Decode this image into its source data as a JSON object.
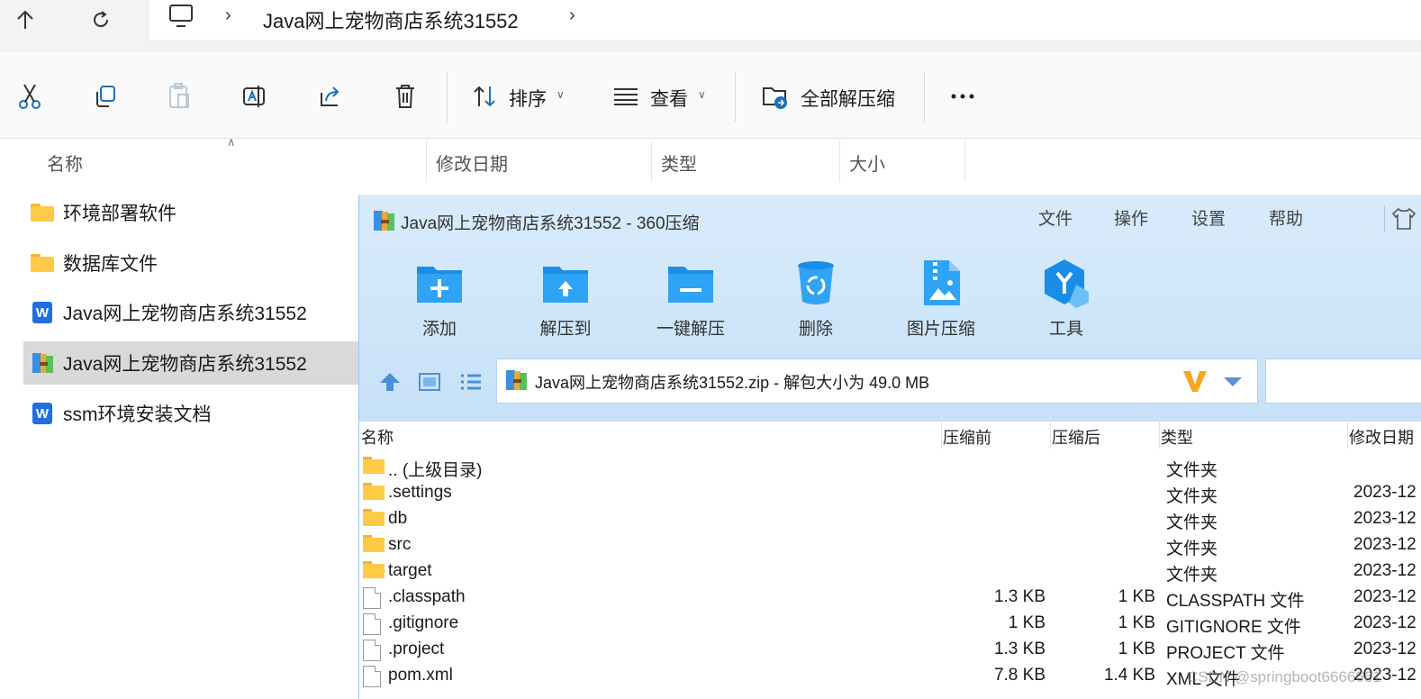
{
  "addressbar": {
    "crumbs": [
      "Java网上宠物商店系统31552"
    ]
  },
  "commandbar": {
    "sort_label": "排序",
    "view_label": "查看",
    "extract_all_label": "全部解压缩"
  },
  "explorer_columns": [
    "名称",
    "修改日期",
    "类型",
    "大小"
  ],
  "explorer_items": [
    {
      "name": "环境部署软件",
      "icon": "folder-icon"
    },
    {
      "name": "数据库文件",
      "icon": "folder-icon"
    },
    {
      "name": "Java网上宠物商店系统31552",
      "icon": "wps-document-icon"
    },
    {
      "name": "Java网上宠物商店系统31552",
      "icon": "zip-archive-icon",
      "selected": true
    },
    {
      "name": "ssm环境安装文档",
      "icon": "wps-document-icon"
    }
  ],
  "app360": {
    "title": "Java网上宠物商店系统31552 - 360压缩",
    "menu": [
      "文件",
      "操作",
      "设置",
      "帮助"
    ],
    "toolbar": [
      "添加",
      "解压到",
      "一键解压",
      "删除",
      "图片压缩",
      "工具"
    ],
    "path_text": "Java网上宠物商店系统31552.zip - 解包大小为 49.0 MB",
    "list_columns": [
      "名称",
      "压缩前",
      "压缩后",
      "类型",
      "修改日期"
    ],
    "rows": [
      {
        "name": ".. (上级目录)",
        "before": "",
        "after": "",
        "type": "文件夹",
        "date": "",
        "icon": "folder-icon"
      },
      {
        "name": ".settings",
        "before": "",
        "after": "",
        "type": "文件夹",
        "date": "2023-12",
        "icon": "folder-icon"
      },
      {
        "name": "db",
        "before": "",
        "after": "",
        "type": "文件夹",
        "date": "2023-12",
        "icon": "folder-icon"
      },
      {
        "name": "src",
        "before": "",
        "after": "",
        "type": "文件夹",
        "date": "2023-12",
        "icon": "folder-icon"
      },
      {
        "name": "target",
        "before": "",
        "after": "",
        "type": "文件夹",
        "date": "2023-12",
        "icon": "folder-icon"
      },
      {
        "name": ".classpath",
        "before": "1.3 KB",
        "after": "1 KB",
        "type": "CLASSPATH 文件",
        "date": "2023-12",
        "icon": "file-icon"
      },
      {
        "name": ".gitignore",
        "before": "1 KB",
        "after": "1 KB",
        "type": "GITIGNORE 文件",
        "date": "2023-12",
        "icon": "file-icon"
      },
      {
        "name": ".project",
        "before": "1.3 KB",
        "after": "1 KB",
        "type": "PROJECT 文件",
        "date": "2023-12",
        "icon": "file-icon"
      },
      {
        "name": "pom.xml",
        "before": "7.8 KB",
        "after": "1.4 KB",
        "type": "XML 文件",
        "date": "2023-12",
        "icon": "file-icon"
      }
    ]
  },
  "watermark": "CSDN @springboot6666661"
}
